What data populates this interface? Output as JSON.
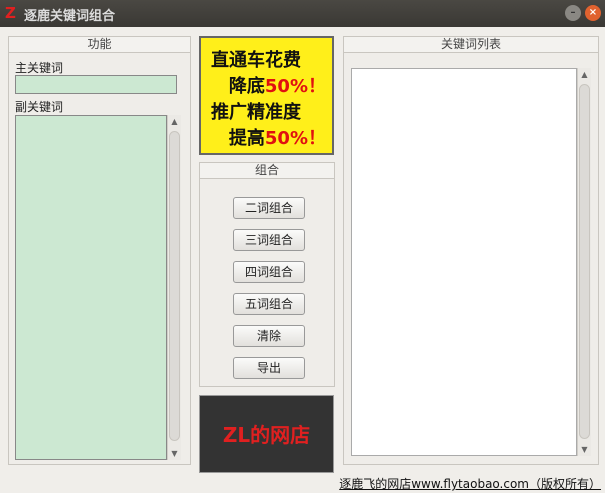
{
  "window": {
    "title": "逐鹿关键词组合",
    "logo_text": "ZL",
    "minimize_icon": "minimize-icon",
    "close_icon": "close-icon"
  },
  "left_panel": {
    "title": "功能",
    "main_keyword_label": "主关键词",
    "main_keyword_value": "",
    "sub_keyword_label": "副关键词",
    "sub_keyword_value": ""
  },
  "ad": {
    "line1": "直通车花费",
    "line2a": "降底",
    "line2b": "50%！",
    "line3": "推广精准度",
    "line4a": "提高",
    "line4b": "50%！"
  },
  "combine_panel": {
    "title": "组合",
    "buttons": [
      "二词组合",
      "三词组合",
      "四词组合",
      "五词组合",
      "清除",
      "导出"
    ]
  },
  "shop_banner": {
    "text": "ZL的网店"
  },
  "right_panel": {
    "title": "关键词列表"
  },
  "footer": {
    "link": "逐鹿飞的网店www.flytaobao.com（版权所有）"
  }
}
